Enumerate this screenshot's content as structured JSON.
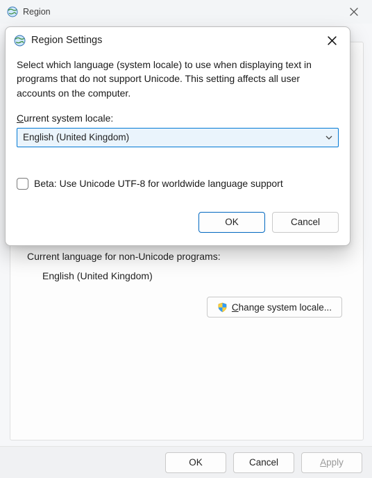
{
  "outer": {
    "title": "Region",
    "lang_label": "Current language for non-Unicode programs:",
    "lang_value": "English (United Kingdom)",
    "change_locale_btn": "Change system locale...",
    "ok": "OK",
    "cancel": "Cancel",
    "apply": "Apply"
  },
  "dialog": {
    "title": "Region Settings",
    "desc": "Select which language (system locale) to use when displaying text in programs that do not support Unicode. This setting affects all user accounts on the computer.",
    "combo_label": "Current system locale:",
    "combo_value": "English (United Kingdom)",
    "checkbox_label": "Beta: Use Unicode UTF-8 for worldwide language support",
    "checkbox_checked": false,
    "ok": "OK",
    "cancel": "Cancel"
  }
}
